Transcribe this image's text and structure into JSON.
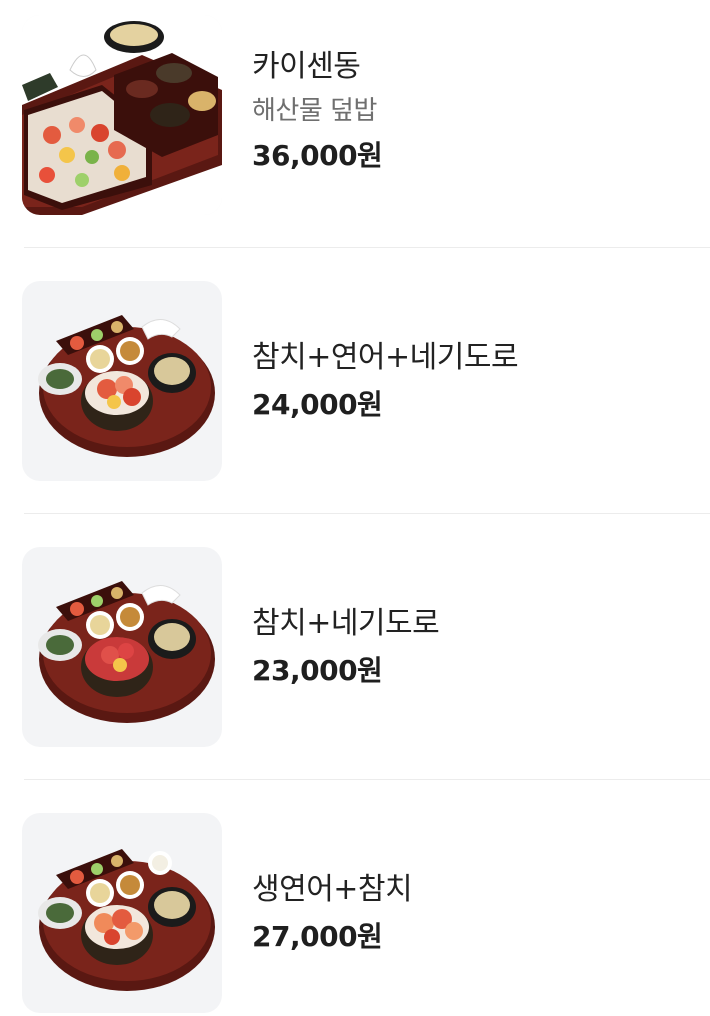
{
  "menu": {
    "items": [
      {
        "name": "카이센동",
        "description": "해산물 덮밥",
        "price": "36,000원",
        "image_icon": "kaisendon-photo"
      },
      {
        "name": "참치+연어+네기도로",
        "price": "24,000원",
        "image_icon": "tuna-salmon-negitoro-set-photo"
      },
      {
        "name": "참치+네기도로",
        "price": "23,000원",
        "image_icon": "tuna-negitoro-set-photo"
      },
      {
        "name": "생연어+참치",
        "price": "27,000원",
        "image_icon": "salmon-tuna-set-photo"
      }
    ]
  },
  "colors": {
    "thumb_background": "#f3f4f6",
    "tray": "#6e1f18",
    "divider": "#ececec",
    "price_text": "#1f1f1f",
    "description_text": "#6f6f6f"
  }
}
